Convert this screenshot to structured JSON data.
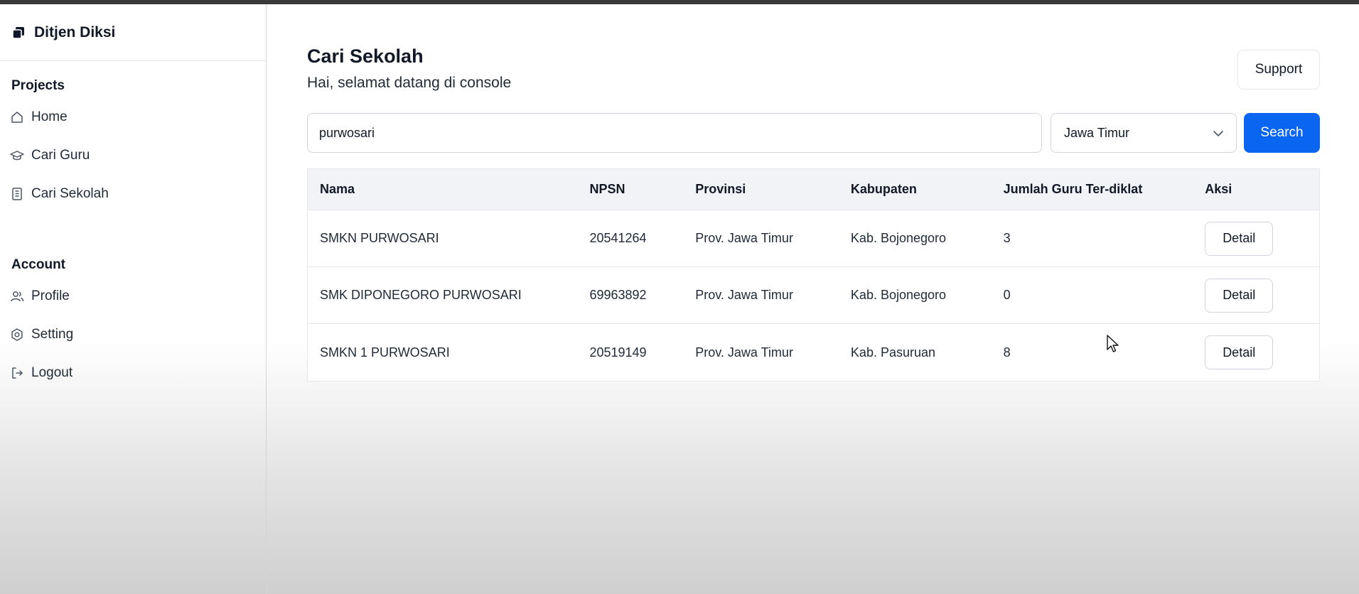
{
  "brand": {
    "name": "Ditjen Diksi",
    "logo_icon": "stack-icon"
  },
  "sidebar": {
    "sections": [
      {
        "title": "Projects",
        "items": [
          {
            "label": "Home",
            "icon": "home-icon"
          },
          {
            "label": "Cari Guru",
            "icon": "graduation-cap-icon"
          },
          {
            "label": "Cari Sekolah",
            "icon": "building-icon"
          }
        ]
      },
      {
        "title": "Account",
        "items": [
          {
            "label": "Profile",
            "icon": "users-icon"
          },
          {
            "label": "Setting",
            "icon": "gear-icon"
          },
          {
            "label": "Logout",
            "icon": "logout-icon"
          }
        ]
      }
    ]
  },
  "header": {
    "title": "Cari Sekolah",
    "subtitle": "Hai, selamat datang di console",
    "support_label": "Support"
  },
  "search": {
    "value": "purwosari",
    "province_selected": "Jawa Timur",
    "button_label": "Search"
  },
  "table": {
    "columns": [
      "Nama",
      "NPSN",
      "Provinsi",
      "Kabupaten",
      "Jumlah Guru Ter-diklat",
      "Aksi"
    ],
    "rows": [
      {
        "nama": "SMKN PURWOSARI",
        "npsn": "20541264",
        "provinsi": "Prov. Jawa Timur",
        "kabupaten": "Kab. Bojonegoro",
        "jumlah": "3",
        "action": "Detail"
      },
      {
        "nama": "SMK DIPONEGORO PURWOSARI",
        "npsn": "69963892",
        "provinsi": "Prov. Jawa Timur",
        "kabupaten": "Kab. Bojonegoro",
        "jumlah": "0",
        "action": "Detail"
      },
      {
        "nama": "SMKN 1 PURWOSARI",
        "npsn": "20519149",
        "provinsi": "Prov. Jawa Timur",
        "kabupaten": "Kab. Pasuruan",
        "jumlah": "8",
        "action": "Detail"
      }
    ]
  },
  "colors": {
    "primary": "#0a66f0",
    "header_bg": "#f1f3f6",
    "border": "#e5e7eb"
  }
}
